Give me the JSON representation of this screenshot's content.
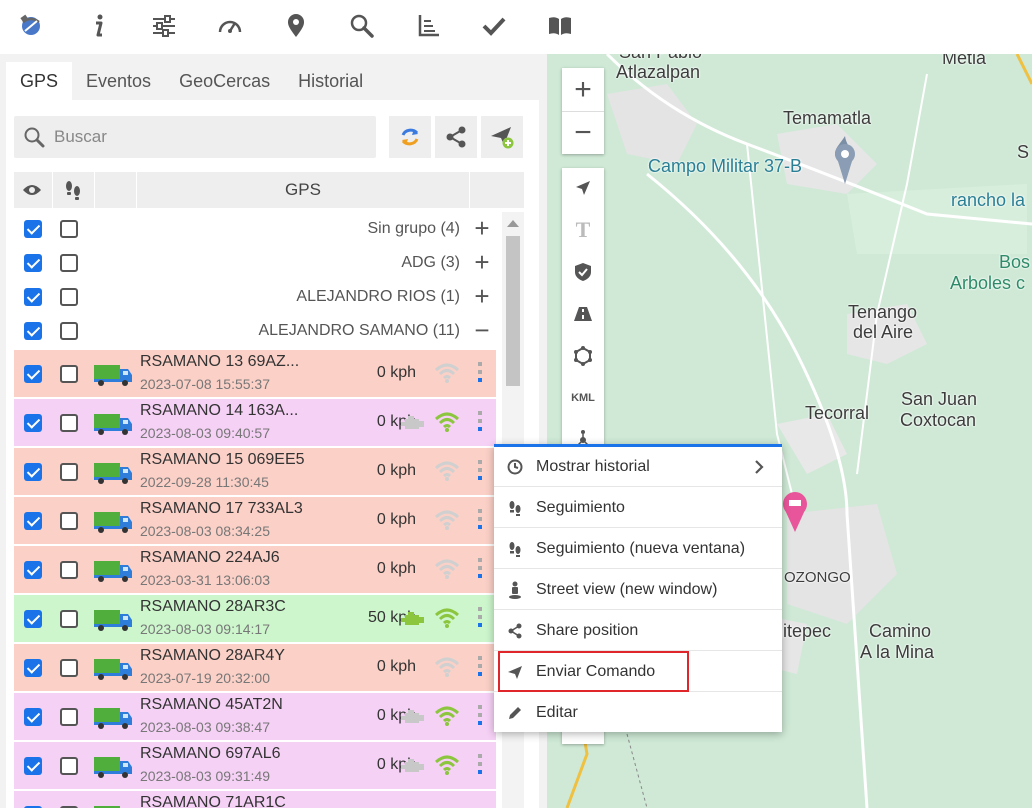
{
  "toolbar": {
    "icons": [
      "satellite-icon",
      "info-icon",
      "sliders-icon",
      "speedometer-icon",
      "map-pin-icon",
      "search-icon",
      "axes-icon",
      "check-icon",
      "book-icon",
      "tools-icon",
      "coins-icon",
      "code-window-icon"
    ]
  },
  "tabs": [
    {
      "label": "GPS",
      "active": true
    },
    {
      "label": "Eventos"
    },
    {
      "label": "GeoCercas"
    },
    {
      "label": "Historial"
    }
  ],
  "search": {
    "placeholder": "Buscar",
    "value": ""
  },
  "table_header": {
    "gps_label": "GPS"
  },
  "groups": [
    {
      "label": "Sin grupo (4)",
      "toggle": "+"
    },
    {
      "label": "ADG (3)",
      "toggle": "+"
    },
    {
      "label": "ALEJANDRO RIOS (1)",
      "toggle": "+"
    },
    {
      "label": "ALEJANDRO SAMANO (11)",
      "toggle": "−"
    }
  ],
  "vehicles": [
    {
      "name": "RSAMANO 13 69AZ...",
      "date": "2023-07-08 15:55:37",
      "speed": "0 kph",
      "status": "offline",
      "engine": false,
      "signal": false
    },
    {
      "name": "RSAMANO 14 163A...",
      "date": "2023-08-03 09:40:57",
      "speed": "0 kph",
      "status": "idle",
      "engine": true,
      "signal": true
    },
    {
      "name": "RSAMANO 15 069EE5",
      "date": "2022-09-28 11:30:45",
      "speed": "0 kph",
      "status": "offline",
      "engine": false,
      "signal": false
    },
    {
      "name": "RSAMANO 17 733AL3",
      "date": "2023-08-03 08:34:25",
      "speed": "0 kph",
      "status": "offline",
      "engine": false,
      "signal": false
    },
    {
      "name": "RSAMANO 224AJ6",
      "date": "2023-03-31 13:06:03",
      "speed": "0 kph",
      "status": "offline",
      "engine": false,
      "signal": false
    },
    {
      "name": "RSAMANO 28AR3C",
      "date": "2023-08-03 09:14:17",
      "speed": "50 kph",
      "status": "moving",
      "engine": true,
      "signal": true
    },
    {
      "name": "RSAMANO 28AR4Y",
      "date": "2023-07-19 20:32:00",
      "speed": "0 kph",
      "status": "offline",
      "engine": false,
      "signal": false
    },
    {
      "name": "RSAMANO 45AT2N",
      "date": "2023-08-03 09:38:47",
      "speed": "0 kph",
      "status": "idle",
      "engine": true,
      "signal": true
    },
    {
      "name": "RSAMANO 697AL6",
      "date": "2023-08-03 09:31:49",
      "speed": "0 kph",
      "status": "idle",
      "engine": true,
      "signal": true
    },
    {
      "name": "RSAMANO 71AR1C",
      "date": "",
      "speed": "",
      "status": "idle",
      "engine": false,
      "signal": false
    }
  ],
  "colors": {
    "offline": "#fbd0c7",
    "idle": "#f6d1f6",
    "moving": "#cdf6cd",
    "accent": "#1a73e8",
    "signal_on": "#8cc63f",
    "signal_off": "#d0d0d0",
    "engine_on": "#8cc63f",
    "engine_off": "#c8c8c8"
  },
  "map": {
    "labels": [
      {
        "text": "San Pablo",
        "cls": ""
      },
      {
        "text": "Atlazalpan",
        "cls": ""
      },
      {
        "text": "Metla",
        "cls": ""
      },
      {
        "text": "Temamatla",
        "cls": ""
      },
      {
        "text": "Campo Militar 37-B",
        "cls": "teal"
      },
      {
        "text": "S",
        "cls": ""
      },
      {
        "text": "rancho la",
        "cls": "teal"
      },
      {
        "text": "Bos",
        "cls": "green"
      },
      {
        "text": "Arboles c",
        "cls": "green"
      },
      {
        "text": "Tenango",
        "cls": ""
      },
      {
        "text": "del Aire",
        "cls": ""
      },
      {
        "text": "Tecorral",
        "cls": ""
      },
      {
        "text": "San Juan",
        "cls": ""
      },
      {
        "text": "Coxtocan",
        "cls": ""
      },
      {
        "text": "OZONGO",
        "cls": "small"
      },
      {
        "text": "nitepec",
        "cls": ""
      },
      {
        "text": "Camino",
        "cls": ""
      },
      {
        "text": "A la Mina",
        "cls": ""
      }
    ],
    "zoom_in": "+",
    "zoom_out": "−",
    "tools": [
      {
        "name": "navigate-icon"
      },
      {
        "name": "text-tool-icon",
        "label": "T"
      },
      {
        "name": "shield-check-icon"
      },
      {
        "name": "road-icon"
      },
      {
        "name": "polygon-icon"
      },
      {
        "name": "kml-icon",
        "label": "KML"
      },
      {
        "name": "network-icon"
      }
    ]
  },
  "context_menu": {
    "items": [
      {
        "label": "Mostrar historial",
        "icon": "clock-icon",
        "submenu": true
      },
      {
        "label": "Seguimiento",
        "icon": "footprints-icon"
      },
      {
        "label": "Seguimiento (nueva ventana)",
        "icon": "footprints-icon"
      },
      {
        "label": "Street view (new window)",
        "icon": "pegman-icon"
      },
      {
        "label": "Share position",
        "icon": "share-icon"
      },
      {
        "label": "Enviar Comando",
        "icon": "send-icon",
        "highlighted": true
      },
      {
        "label": "Editar",
        "icon": "pencil-icon"
      }
    ]
  }
}
